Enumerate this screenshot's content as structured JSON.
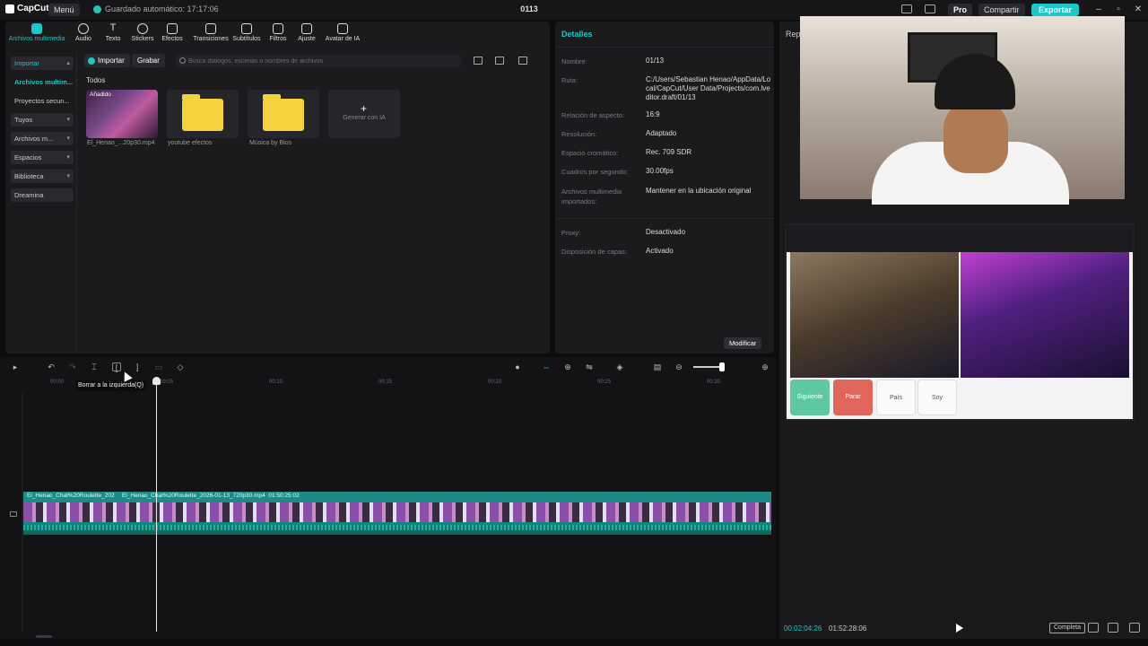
{
  "topbar": {
    "logo": "CapCut",
    "menu": "Menú",
    "autosave": "Guardado automático: 17:17:06",
    "project_title": "0113",
    "pro": "Pro",
    "share": "Compartir",
    "export": "Exportar"
  },
  "tool_tabs": [
    {
      "label": "Archivos multimedia",
      "icon": "media-icon"
    },
    {
      "label": "Audio",
      "icon": "audio-icon"
    },
    {
      "label": "Texto",
      "icon": "text-icon"
    },
    {
      "label": "Stickers",
      "icon": "sticker-icon"
    },
    {
      "label": "Efectos",
      "icon": "effects-icon"
    },
    {
      "label": "Transiciones",
      "icon": "transitions-icon"
    },
    {
      "label": "Subtítulos",
      "icon": "subtitles-icon"
    },
    {
      "label": "Filtros",
      "icon": "filters-icon"
    },
    {
      "label": "Ajuste",
      "icon": "adjust-icon"
    },
    {
      "label": "Avatar de IA",
      "icon": "avatar-icon"
    }
  ],
  "side_nav": [
    {
      "label": "Importar",
      "has_chevron": true
    },
    {
      "label": "Archivos multim...",
      "has_chevron": false
    },
    {
      "label": "Proyectos secun...",
      "has_chevron": false
    },
    {
      "label": "Tuyos",
      "has_chevron": true
    },
    {
      "label": "Archivos m...",
      "has_chevron": true
    },
    {
      "label": "Espacios",
      "has_chevron": true
    },
    {
      "label": "Biblioteca",
      "has_chevron": true
    },
    {
      "label": "Dreamina",
      "has_chevron": false
    }
  ],
  "media": {
    "import_button": "Importar",
    "record_button": "Grabar",
    "search_placeholder": "Busca diálogos, escenas o nombres de archivos",
    "section_title": "Todos",
    "added_badge": "Añadido",
    "items": [
      {
        "label": "El_Henao_...20p30.mp4"
      },
      {
        "label": "youtube efectos"
      },
      {
        "label": "Música by Bios"
      },
      {
        "label": "Generar con IA"
      }
    ]
  },
  "details": {
    "title": "Detalles",
    "rows": [
      {
        "label": "Nombre:",
        "value": "01/13"
      },
      {
        "label": "Ruta:",
        "value": "C:/Users/Sebastian Henao/AppData/Local/CapCut/User Data/Projects/com.lveditor.draft/01/13"
      },
      {
        "label": "Relación de aspecto:",
        "value": "16:9"
      },
      {
        "label": "Resolución:",
        "value": "Adaptado"
      },
      {
        "label": "Espacio cromático:",
        "value": "Rec. 709 SDR"
      },
      {
        "label": "Cuadros por segundo:",
        "value": "30.00fps"
      },
      {
        "label": "Archivos multimedia importados:",
        "value": "Mantener en la ubicación original"
      },
      {
        "label": "Proxy:",
        "value": "Desactivado"
      },
      {
        "label": "Disposición de capas:",
        "value": "Activado"
      }
    ],
    "modify_button": "Modificar"
  },
  "player": {
    "label": "Rep",
    "current_time": "00:02:04:26",
    "total_time": "01:52:28:06",
    "full_button": "Completa",
    "preview_buttons": [
      "Siguiente",
      "Parar",
      "País",
      "Soy"
    ]
  },
  "timeline": {
    "tooltip": "Borrar a la izquierda(Q)",
    "ruler_labels": [
      "00:00",
      "00:05",
      "00:10",
      "00:15",
      "00:20",
      "00:25",
      "00:30"
    ],
    "clip_name_short": "El_Henao_Chat%20Roulette_202",
    "clip_name_full": "El_Henao_Chat%20Roulette_2026-01-13_720p30.mp4",
    "clip_duration": "01:50:25:02"
  }
}
